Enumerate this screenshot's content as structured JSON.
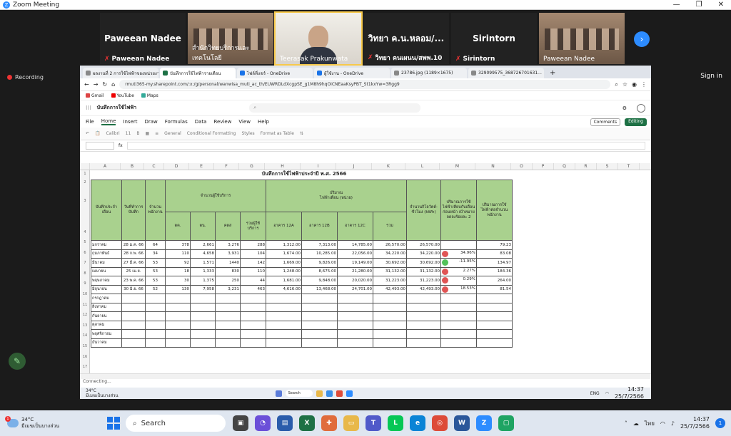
{
  "zoom": {
    "title": "Zoom Meeting",
    "controls": [
      "—",
      "❐",
      "✕"
    ],
    "recording": "Recording",
    "signin": "Sign in",
    "participants": [
      {
        "name": "Paweean Nadee",
        "caption": "Paweean Nadee",
        "kind": "name"
      },
      {
        "name": "",
        "caption": "สำนักวิทยบริการและเทคโนโลยี",
        "kind": "video"
      },
      {
        "name": "",
        "caption": "Teerasak Prakunwata",
        "kind": "speaker"
      },
      {
        "name": "วิทยา  ค.น.หลอม/...",
        "caption": "วิทยา  คนเผนน/สพพ.10",
        "kind": "name"
      },
      {
        "name": "Sirintorn",
        "caption": "Sirintorn",
        "kind": "name"
      },
      {
        "name": "",
        "caption": "Paweean Nadee",
        "kind": "video"
      }
    ]
  },
  "browser": {
    "tabs": [
      {
        "label": "ผลงานที่ 2 การใช้ไฟฟ้าของหน่วยงาน",
        "icon": "g"
      },
      {
        "label": "บันทึกการใช้ไฟฟ้ารายเดือน",
        "icon": "x",
        "active": true
      },
      {
        "label": "ไฟล์ที่แชร์ - OneDrive",
        "icon": "b"
      },
      {
        "label": "ผู้ใช้งาน - OneDrive",
        "icon": "b"
      },
      {
        "label": "23786.jpg (1189×1675)",
        "icon": "g"
      },
      {
        "label": "329099575_368726701631...",
        "icon": "g"
      }
    ],
    "url": "rmuti365-my.sharepoint.com/:x:/g/personal/wanwisa_muti_ac_th/EUWRDLdXcgpSE_g1M8h9hqOiCNEaaKsyPBT_St1kxYw=3Rgg9",
    "bookmarks": [
      "Gmail",
      "YouTube",
      "Maps"
    ]
  },
  "excel": {
    "doc_name": "บันทึกการใช้ไฟฟ้า",
    "search_placeholder": "",
    "menus": [
      "File",
      "Home",
      "Insert",
      "Draw",
      "Formulas",
      "Data",
      "Review",
      "View",
      "Help"
    ],
    "comments": "Comments",
    "editing": "Editing",
    "ribbon": [
      "Calibri",
      "11",
      "General",
      "Conditional Formatting",
      "Styles",
      "Format as Table"
    ],
    "columns": [
      "A",
      "B",
      "C",
      "D",
      "E",
      "F",
      "G",
      "H",
      "I",
      "J",
      "K",
      "L",
      "M",
      "N",
      "O",
      "P",
      "Q",
      "R",
      "S",
      "T"
    ],
    "sheet_title": "บันทึกการใช้ไฟฟ้าประจำปี พ.ศ. 2566",
    "headers": {
      "month": "บันทึกประจำเดือน",
      "date": "วันที่ทำการบันทึก",
      "staff": "จำนวนพนักงาน",
      "users_group": "จำนวนผู้ใช้บริการ",
      "users": [
        "ตค.",
        "ตน.",
        "คตส",
        "รวมผู้ใช้บริการ"
      ],
      "amount_group": "ปริมาณ\nไฟฟ้าเดือน (หน่วย)",
      "amount": [
        "อาคาร 12A",
        "อาคาร 12B",
        "อาคาร 12C",
        "รวม"
      ],
      "total": "จำนวนกิโลวัตต์-ชั่วโมง (kWh)",
      "compare": "ปริมาณการใช้ไฟฟ้าเทียบกับเดือนก่อนหน้า เป้าหมายลดลงร้อยละ 2",
      "per_staff": "ปริมาณการใช้ไฟฟ้าต่อจำนวนพนักงาน"
    },
    "rows": [
      {
        "n": "5",
        "month": "มกราคม",
        "date": "28 ม.ค. 66",
        "staff": "64",
        "u1": "378",
        "u2": "2,661",
        "u3": "3,276",
        "u4": "288",
        "a": "1,312.00",
        "b": "7,313.00",
        "c": "14,785.00",
        "sum": "26,570.00",
        "kwh": "26,570.00",
        "flag": "",
        "pct": "",
        "per": "79.23"
      },
      {
        "n": "6",
        "month": "กุมภาพันธ์",
        "date": "28 ก.พ. 66",
        "staff": "34",
        "u1": "110",
        "u2": "4,658",
        "u3": "3,931",
        "u4": "104",
        "a": "1,674.00",
        "b": "10,285.00",
        "c": "22,056.00",
        "sum": "34,220.00",
        "kwh": "34,220.00",
        "flag": "red",
        "pct": "34.96%",
        "per": "83.08"
      },
      {
        "n": "7",
        "month": "มีนาคม",
        "date": "27 มี.ค. 66",
        "staff": "53",
        "u1": "92",
        "u2": "1,571",
        "u3": "1440",
        "u4": "142",
        "a": "1,669.00",
        "b": "9,826.00",
        "c": "19,149.00",
        "sum": "30,692.00",
        "kwh": "30,692.00",
        "flag": "green",
        "pct": "-11.95%",
        "per": "134.97"
      },
      {
        "n": "8",
        "month": "เมษายน",
        "date": "25 เม.ย.",
        "staff": "53",
        "u1": "18",
        "u2": "1,333",
        "u3": "830",
        "u4": "110",
        "a": "1,248.00",
        "b": "8,675.00",
        "c": "21,280.00",
        "sum": "31,132.00",
        "kwh": "31,132.00",
        "flag": "red",
        "pct": "2.27%",
        "per": "184.36"
      },
      {
        "n": "9",
        "month": "พฤษภาคม",
        "date": "23 พ.ค. 66",
        "staff": "53",
        "u1": "30",
        "u2": "1,375",
        "u3": "250",
        "u4": "44",
        "a": "1,681.00",
        "b": "9,848.00",
        "c": "20,020.00",
        "sum": "31,223.00",
        "kwh": "31,223.00",
        "flag": "red",
        "pct": "0.29%",
        "per": "264.00"
      },
      {
        "n": "10",
        "month": "มิถุนายน",
        "date": "30 มิ.ย. 66",
        "staff": "52",
        "u1": "130",
        "u2": "7,958",
        "u3": "3,231",
        "u4": "463",
        "a": "4,616.00",
        "b": "13,468.00",
        "c": "24,701.00",
        "sum": "42,493.00",
        "kwh": "42,493.00",
        "flag": "red",
        "pct": "18.53%",
        "per": "81.54"
      }
    ],
    "empty_months": [
      "กรกฎาคม",
      "สิงหาคม",
      "กันยายน",
      "ตุลาคม",
      "พฤศจิกายน",
      "ธันวาคม"
    ],
    "status": "Connecting..."
  },
  "inner_taskbar": {
    "weather_temp": "34°C",
    "weather_desc": "มีเมฆเป็นบางส่วน",
    "search": "Search",
    "lang": "ENG",
    "time": "14:37",
    "date": "25/7/2566"
  },
  "taskbar": {
    "weather_temp": "34°C",
    "weather_desc": "มีเมฆเป็นบางส่วน",
    "weather_badge": "1",
    "search": "Search",
    "lang": "ไทย",
    "time": "14:37",
    "date": "25/7/2566",
    "notif": "1"
  }
}
